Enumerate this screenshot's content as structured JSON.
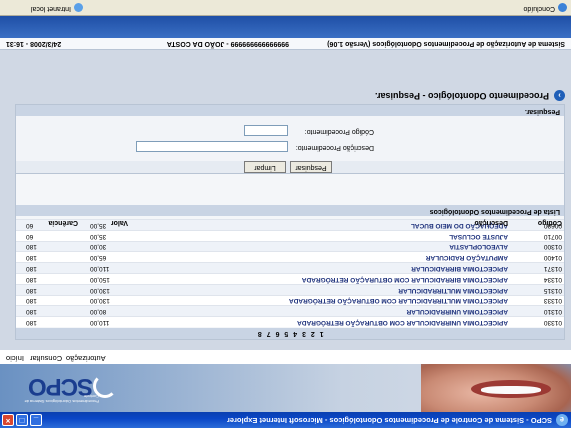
{
  "window": {
    "title": "SCPO - Sistema de Controle de Procedimentos Odontológicos - Microsoft Internet Explorer",
    "minimize": "_",
    "maximize": "□",
    "close": "×"
  },
  "header": {
    "brand": "SCPO",
    "tagline": "Procedimentos Odontológicos Sistema de Controle",
    "ie_icon": "e"
  },
  "menu": {
    "items": [
      "Início",
      "Consultar",
      "Autorização"
    ]
  },
  "page": {
    "title": "Procedimento Odontológico - Pesquisar.",
    "icon": "arrow-circle-icon"
  },
  "search": {
    "panel_label": "Pesquisar.",
    "code_label": "Código Procedimento:",
    "code_value": "",
    "desc_label": "Descrição Procedimento:",
    "desc_value": "",
    "search_button": "Pesquisar",
    "clear_button": "Limpar"
  },
  "list": {
    "panel_label": "Lista de Procedimentos Odontológicos",
    "columns": [
      "Código",
      "Descrição",
      "Valor",
      "Carência"
    ],
    "rows": [
      {
        "code": "00680",
        "desc": "ADEQUAÇÃO DO MEIO BUCAL",
        "valor": "35,00",
        "carencia": "60"
      },
      {
        "code": "00710",
        "desc": "AJUSTE OCLUSAL",
        "valor": "35,00",
        "carencia": "60"
      },
      {
        "code": "01300",
        "desc": "ALVEOLOPLASTIA",
        "valor": "30,00",
        "carencia": "180"
      },
      {
        "code": "01400",
        "desc": "AMPUTAÇÃO RADICULAR",
        "valor": "65,00",
        "carencia": "180"
      },
      {
        "code": "01371",
        "desc": "APICECTOMIA BIRRADICULAR",
        "valor": "110,00",
        "carencia": "180"
      },
      {
        "code": "01334",
        "desc": "APICECTOMIA BIRRADICULAR COM OBTURAÇÃO RETRÓGRADA",
        "valor": "150,00",
        "carencia": "180"
      },
      {
        "code": "01315",
        "desc": "APICECTOMIA MULTIRRADICULAR",
        "valor": "130,00",
        "carencia": "180"
      },
      {
        "code": "01333",
        "desc": "APICECTOMIA MULTIRRADICULAR COM OBTURAÇÃO RETRÓGRADA",
        "valor": "130,00",
        "carencia": "180"
      },
      {
        "code": "01310",
        "desc": "APICECTOMIA UNIRRADICULAR",
        "valor": "80,00",
        "carencia": "180"
      },
      {
        "code": "01330",
        "desc": "APICECTOMIA UNIRRADICULAR COM OBTURAÇÃO RETRÓGRADA",
        "valor": "110,00",
        "carencia": "180"
      }
    ],
    "pager": "1 2 3 4 5 6 7 8"
  },
  "info": {
    "system": "Sistema de Autorização de Procedimentos Odontológicos (Versão 1.06)",
    "user": "999999999999999 - JOÃO DA COSTA",
    "datetime": "24/3/2008 - 16:31"
  },
  "status": {
    "left": "Concluído",
    "zone": "Intranet local"
  }
}
